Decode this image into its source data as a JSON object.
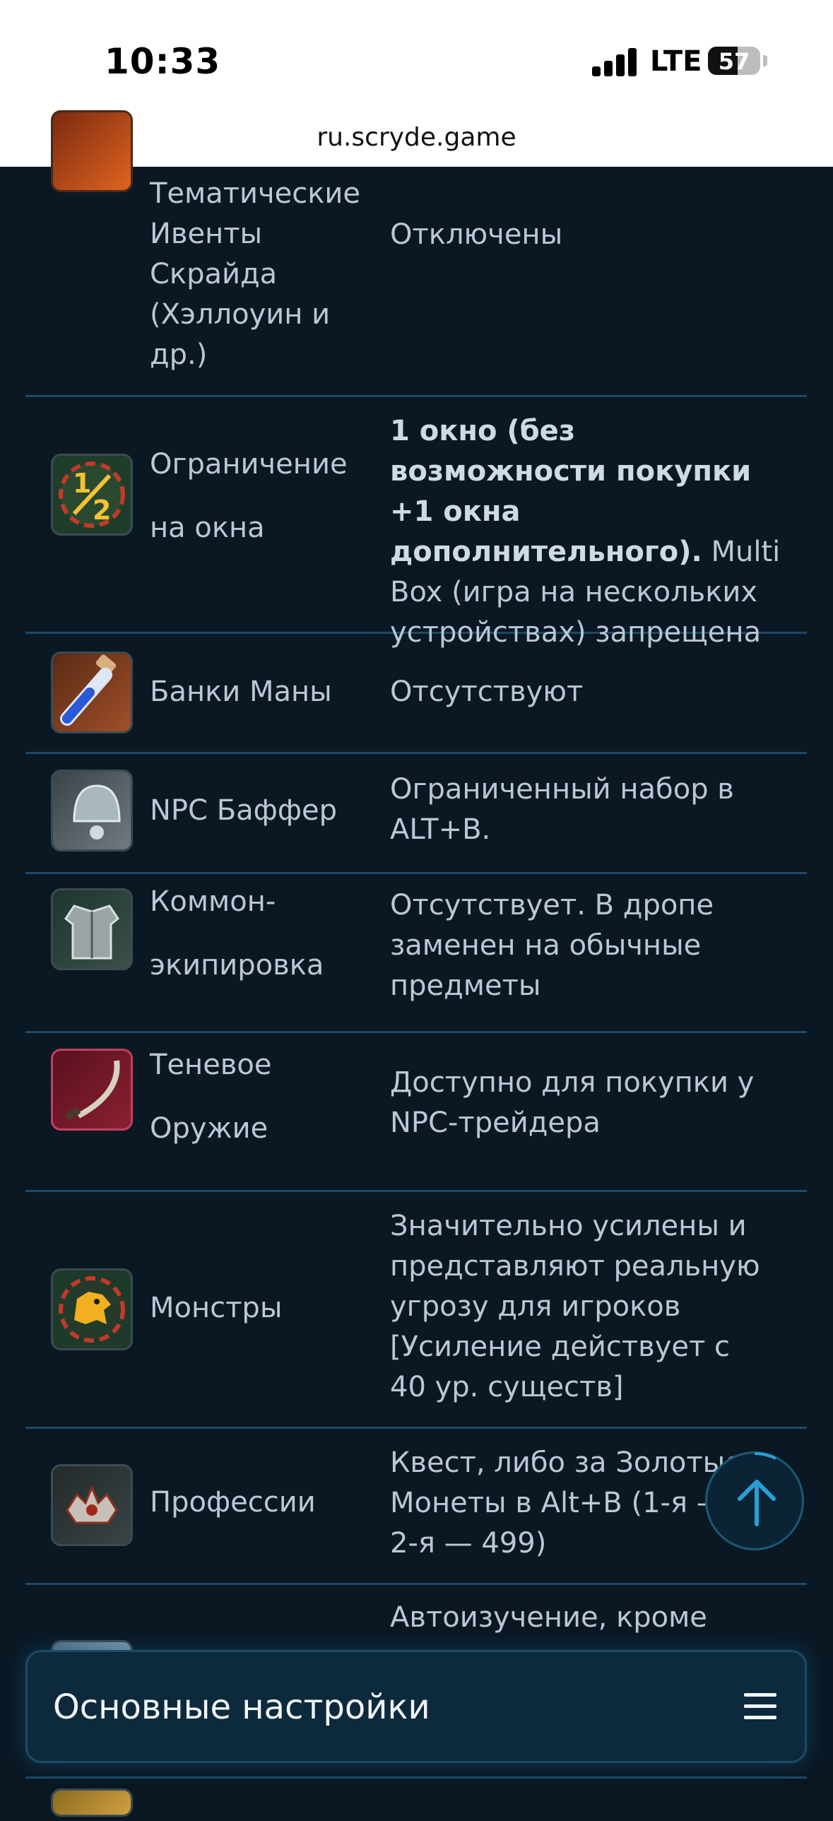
{
  "status_bar": {
    "time": "10:33",
    "network": "LTE",
    "battery": "57"
  },
  "browser": {
    "url": "ru.scryde.game"
  },
  "table": {
    "rows": [
      {
        "name": "Тематические Ивенты Скрайда (Хэллоуин и др.)",
        "value": "Отключены",
        "icon": "event-icon"
      },
      {
        "name": "Ограничение на окна",
        "value_bold": "1 окно (без возможности покупки +1 окна дополнительного).",
        "value": "Multi Box (игра на нескольких устройствах) запрещена",
        "icon": "half-window-icon"
      },
      {
        "name": "Банки Маны",
        "value": "Отсутствуют",
        "icon": "mana-potion-icon"
      },
      {
        "name": "NPC Баффер",
        "value": "Ограниченный набор в ALT+B.",
        "icon": "buffer-bell-icon"
      },
      {
        "name": "Коммон-экипировка",
        "value": "Отсутствует. В дропе заменен на обычные предметы",
        "icon": "common-armor-icon"
      },
      {
        "name": "Теневое Оружие",
        "value": "Доступно для покупки у NPC-трейдера",
        "icon": "shadow-weapon-icon"
      },
      {
        "name": "Монстры",
        "value": "Значительно усилены и представляют реальную угрозу для игроков [Усиление действует с 40 ур. существ]",
        "icon": "monster-icon"
      },
      {
        "name": "Профессии",
        "value": "Квест, либо за Золотые Монеты в Alt+B (1-я — 1",
        "value_line3": "2-я — 499)",
        "icon": "profession-icon"
      },
      {
        "name": "",
        "value": "Автоизучение, кроме",
        "icon": "skill-icon"
      }
    ]
  },
  "bottom_nav": {
    "title": "Основные настройки"
  },
  "colors": {
    "background": "#0a1823",
    "divider": "#1c4a66",
    "text": "#b9c8d4",
    "accent": "#2a9fd6"
  }
}
